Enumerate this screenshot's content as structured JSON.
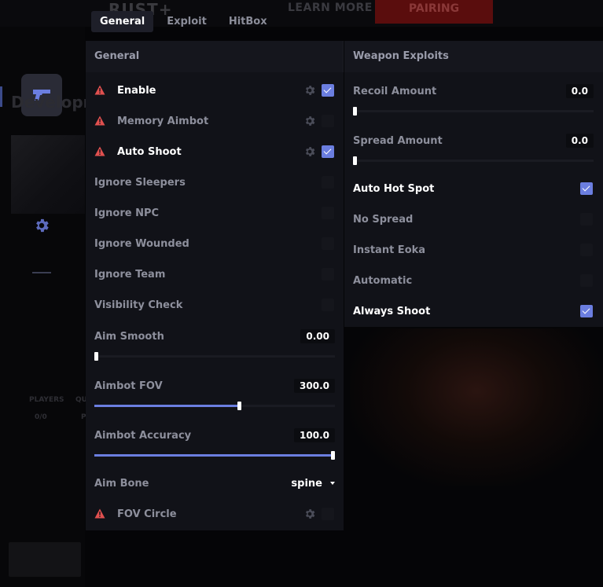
{
  "background": {
    "logo_text": "RUST+",
    "learn_more": "LEARN MORE",
    "pairing": "PAIRING",
    "heading": "Developm",
    "stats": [
      {
        "label": "PLAYERS",
        "value": "0/0"
      },
      {
        "label": "QU",
        "value": "P"
      }
    ]
  },
  "tabs": [
    {
      "label": "General",
      "active": true
    },
    {
      "label": "Exploit",
      "active": false
    },
    {
      "label": "HitBox",
      "active": false
    }
  ],
  "general": {
    "header": "General",
    "toggles": [
      {
        "label": "Enable",
        "warn": true,
        "gear": true,
        "checked": true,
        "bright": true
      },
      {
        "label": "Memory Aimbot",
        "warn": true,
        "gear": true,
        "checked": false,
        "bright": false
      },
      {
        "label": "Auto Shoot",
        "warn": true,
        "gear": true,
        "checked": true,
        "bright": true
      },
      {
        "label": "Ignore Sleepers",
        "warn": false,
        "gear": false,
        "checked": false,
        "bright": false
      },
      {
        "label": "Ignore NPC",
        "warn": false,
        "gear": false,
        "checked": false,
        "bright": false
      },
      {
        "label": "Ignore Wounded",
        "warn": false,
        "gear": false,
        "checked": false,
        "bright": false
      },
      {
        "label": "Ignore Team",
        "warn": false,
        "gear": false,
        "checked": false,
        "bright": false
      },
      {
        "label": "Visibility Check",
        "warn": false,
        "gear": false,
        "checked": false,
        "bright": false
      }
    ],
    "sliders": [
      {
        "label": "Aim Smooth",
        "value": "0.00",
        "fill": 0.0
      },
      {
        "label": "Aimbot FOV",
        "value": "300.0",
        "fill": 0.6
      },
      {
        "label": "Aimbot Accuracy",
        "value": "100.0",
        "fill": 1.0
      }
    ],
    "aim_bone": {
      "label": "Aim Bone",
      "value": "spine"
    },
    "fov_circle": {
      "label": "FOV Circle",
      "warn": true,
      "gear": true,
      "checked": false
    }
  },
  "weapon": {
    "header": "Weapon Exploits",
    "sliders": [
      {
        "label": "Recoil Amount",
        "value": "0.0",
        "fill": 0.0
      },
      {
        "label": "Spread Amount",
        "value": "0.0",
        "fill": 0.0
      }
    ],
    "toggles": [
      {
        "label": "Auto Hot Spot",
        "checked": true,
        "bright": true
      },
      {
        "label": "No Spread",
        "checked": false,
        "bright": false
      },
      {
        "label": "Instant Eoka",
        "checked": false,
        "bright": false
      },
      {
        "label": "Automatic",
        "checked": false,
        "bright": false
      },
      {
        "label": "Always Shoot",
        "checked": true,
        "bright": true
      }
    ]
  },
  "colors": {
    "accent": "#6b7ee0",
    "warning": "#e0504f",
    "panel": "#111218"
  }
}
